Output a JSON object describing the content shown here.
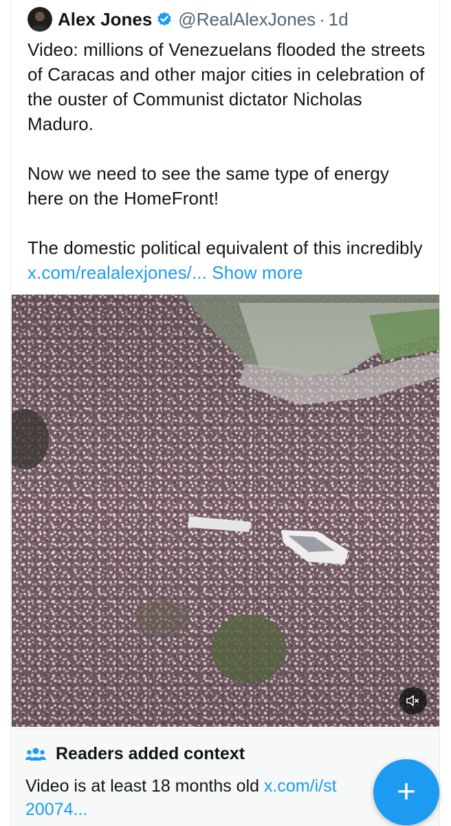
{
  "post": {
    "author_name": "Alex Jones",
    "handle": "@RealAlexJones",
    "separator": "·",
    "time": "1d",
    "paragraphs": [
      "Video: millions of Venezuelans flooded the streets of Caracas and other major cities in celebration of the ouster of Communist dictator Nicholas Maduro.",
      "Now we need to see the same type of energy here on the HomeFront!"
    ],
    "last_paragraph_text": "The domestic political equivalent of this incredibly ",
    "truncated_link": "x.com/realalexjones/...",
    "show_more": "Show more"
  },
  "media": {
    "type": "video",
    "mute_icon": "speaker-muted-icon"
  },
  "context_note": {
    "title": "Readers added context",
    "text": "Video is at least 18 months old ",
    "link": "x.com/i/st",
    "link_continued": "20074..."
  },
  "compose_button": {
    "label": "+"
  },
  "colors": {
    "accent": "#1d9bf0",
    "text": "#0f1419",
    "secondary_text": "#536471",
    "note_background": "#f7f9f9"
  }
}
